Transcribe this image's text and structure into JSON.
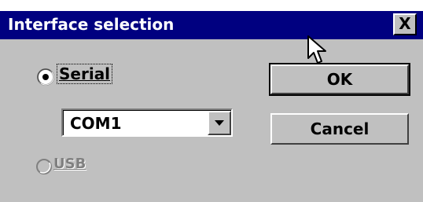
{
  "window": {
    "title": "Interface selection",
    "close_glyph": "X"
  },
  "options": {
    "serial_label": "Serial",
    "usb_label": "USB",
    "selected": "Serial"
  },
  "port_select": {
    "value": "COM1"
  },
  "buttons": {
    "ok_label": "OK",
    "cancel_label": "Cancel"
  },
  "icons": {
    "close": "close-icon",
    "dropdown": "chevron-down-icon",
    "cursor": "mouse-pointer-icon"
  },
  "colors": {
    "titlebar": "#000080",
    "face": "#c0c0c0"
  }
}
